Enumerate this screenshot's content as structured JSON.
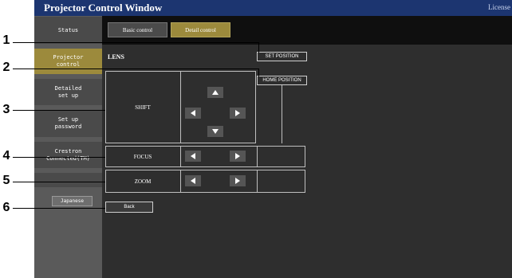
{
  "app": {
    "title": "Projector Control Window",
    "license_label": "License"
  },
  "sidebar": {
    "items": [
      {
        "lines": [
          "Status"
        ]
      },
      {
        "lines": [
          "Projector",
          "control"
        ]
      },
      {
        "lines": [
          "Detailed",
          "set up"
        ]
      },
      {
        "lines": [
          "Set up",
          "password"
        ]
      },
      {
        "lines": [
          "Crestron",
          "Connected(TM)"
        ]
      }
    ],
    "language_button": "Japanese"
  },
  "tabs": {
    "basic": "Basic control",
    "detail": "Detail control"
  },
  "lens": {
    "heading": "LENS",
    "set_position": "SET POSITION",
    "home_position": "HOME POSITION",
    "shift_label": "SHIFT",
    "focus_label": "FOCUS",
    "zoom_label": "ZOOM",
    "back": "Back"
  },
  "callouts": [
    "1",
    "2",
    "3",
    "4",
    "5",
    "6"
  ],
  "colors": {
    "titlebar": "#1c3570",
    "active": "#9c8a3c",
    "background": "#2e2e2e"
  }
}
